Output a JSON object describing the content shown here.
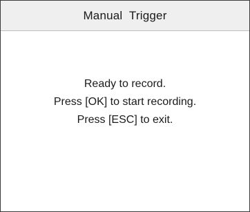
{
  "window": {
    "title": "Manual  Trigger"
  },
  "message": {
    "lines": [
      "Ready to record.",
      "Press [OK] to start recording.",
      "Press [ESC] to exit."
    ]
  }
}
